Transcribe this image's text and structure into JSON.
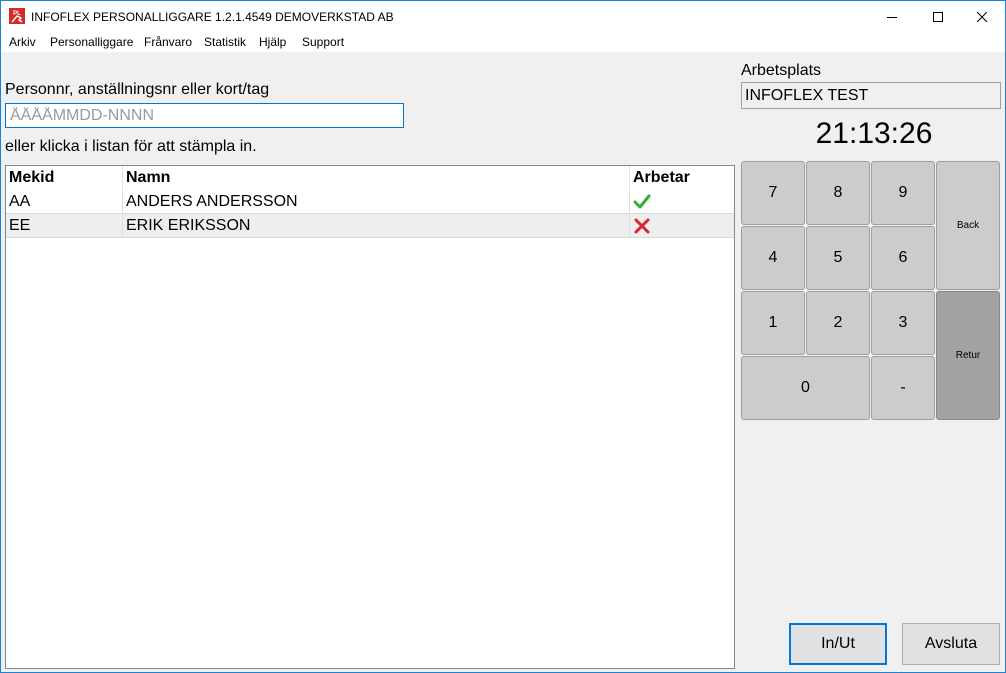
{
  "window": {
    "title": "INFOFLEX PERSONALLIGGARE 1.2.1.4549 DEMOVERKSTAD AB",
    "icon_text": "PL"
  },
  "menu": [
    "Arkiv",
    "Personalliggare",
    "Frånvaro",
    "Statistik",
    "Hjälp",
    "Support"
  ],
  "search": {
    "label": "Personnr, anställningsnr eller kort/tag",
    "placeholder": "ÅÅÅÅMMDD-NNNN",
    "value": "",
    "hint": "eller klicka i listan för att stämpla in."
  },
  "table": {
    "headers": [
      "Mekid",
      "Namn",
      "Arbetar"
    ],
    "rows": [
      {
        "mekid": "AA",
        "name": "ANDERS ANDERSSON",
        "working": true
      },
      {
        "mekid": "EE",
        "name": "ERIK ERIKSSON",
        "working": false
      }
    ]
  },
  "workplace": {
    "label": "Arbetsplats",
    "value": "INFOFLEX TEST"
  },
  "clock": "21:13:26",
  "keypad": {
    "k7": "7",
    "k8": "8",
    "k9": "9",
    "k4": "4",
    "k5": "5",
    "k6": "6",
    "k1": "1",
    "k2": "2",
    "k3": "3",
    "k0": "0",
    "dash": "-",
    "back": "Back",
    "retur": "Retur"
  },
  "buttons": {
    "inout": "In/Ut",
    "quit": "Avsluta"
  },
  "colors": {
    "accent": "#0078d7",
    "check": "#3aa935",
    "cross": "#d9262c"
  }
}
